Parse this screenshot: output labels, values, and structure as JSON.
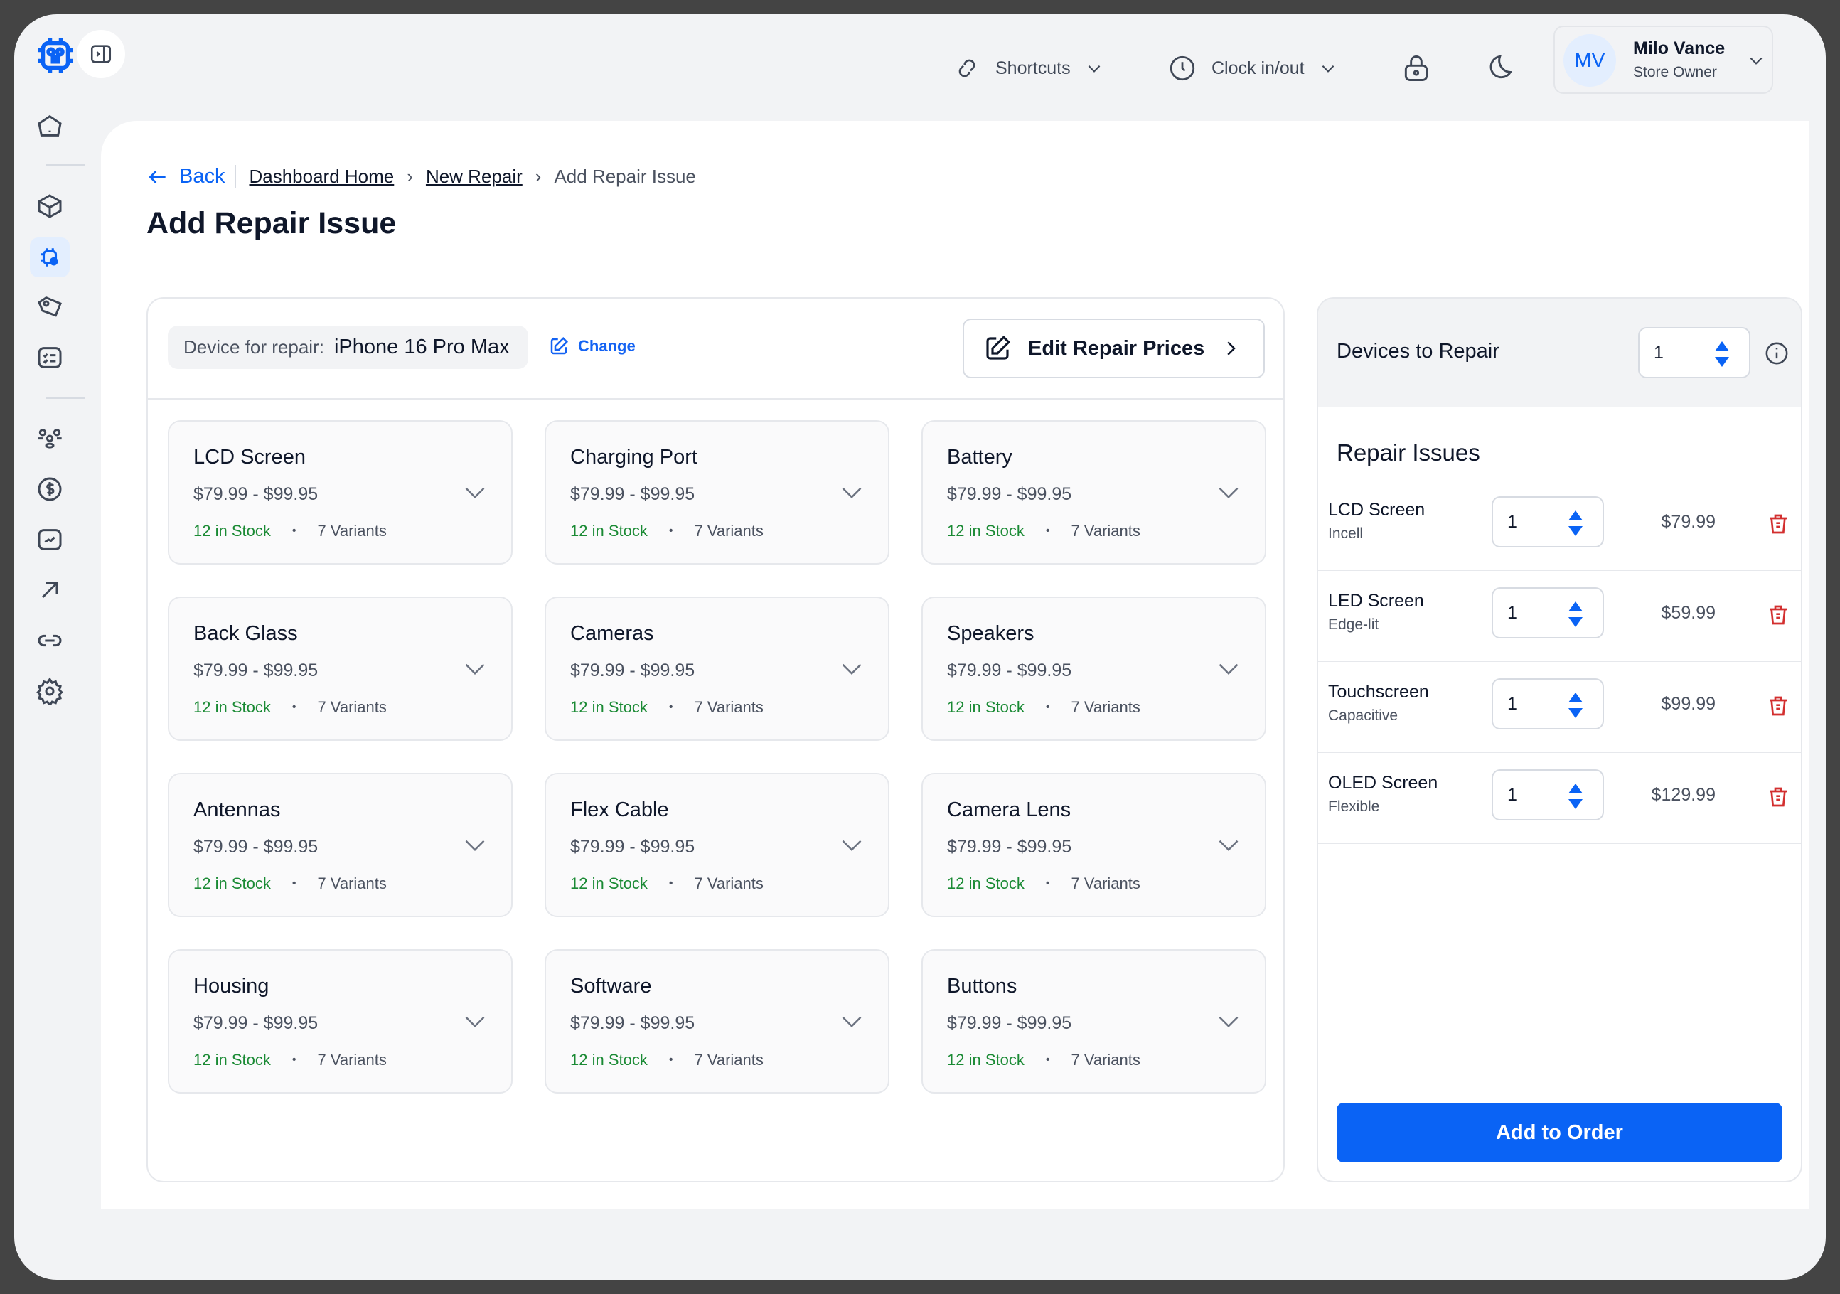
{
  "header": {
    "shortcuts_label": "Shortcuts",
    "clock_label": "Clock in/out",
    "user": {
      "initials": "MV",
      "name": "Milo Vance",
      "role": "Store Owner"
    }
  },
  "breadcrumb": {
    "back": "Back",
    "items": [
      "Dashboard Home",
      "New Repair"
    ],
    "current": "Add Repair Issue"
  },
  "page_title": "Add Repair Issue",
  "device": {
    "label": "Device for repair:",
    "value": "iPhone 16 Pro Max",
    "change": "Change"
  },
  "edit_prices_label": "Edit Repair Prices",
  "issues": [
    {
      "name": "LCD Screen",
      "price": "$79.99 - $99.95",
      "stock": "12 in Stock",
      "variants": "7 Variants"
    },
    {
      "name": "Charging Port",
      "price": "$79.99 - $99.95",
      "stock": "12 in Stock",
      "variants": "7 Variants"
    },
    {
      "name": "Battery",
      "price": "$79.99 - $99.95",
      "stock": "12 in Stock",
      "variants": "7 Variants"
    },
    {
      "name": "Back Glass",
      "price": "$79.99 - $99.95",
      "stock": "12 in Stock",
      "variants": "7 Variants"
    },
    {
      "name": "Cameras",
      "price": "$79.99 - $99.95",
      "stock": "12 in Stock",
      "variants": "7 Variants"
    },
    {
      "name": "Speakers",
      "price": "$79.99 - $99.95",
      "stock": "12 in Stock",
      "variants": "7 Variants"
    },
    {
      "name": "Antennas",
      "price": "$79.99 - $99.95",
      "stock": "12 in Stock",
      "variants": "7 Variants"
    },
    {
      "name": "Flex Cable",
      "price": "$79.99 - $99.95",
      "stock": "12 in Stock",
      "variants": "7 Variants"
    },
    {
      "name": "Camera Lens",
      "price": "$79.99 - $99.95",
      "stock": "12 in Stock",
      "variants": "7 Variants"
    },
    {
      "name": "Housing",
      "price": "$79.99 - $99.95",
      "stock": "12 in Stock",
      "variants": "7 Variants"
    },
    {
      "name": "Software",
      "price": "$79.99 - $99.95",
      "stock": "12 in Stock",
      "variants": "7 Variants"
    },
    {
      "name": "Buttons",
      "price": "$79.99 - $99.95",
      "stock": "12 in Stock",
      "variants": "7 Variants"
    }
  ],
  "summary": {
    "devices_label": "Devices to Repair",
    "devices_qty": "1",
    "issues_title": "Repair Issues",
    "items": [
      {
        "name": "LCD Screen",
        "type": "Incell",
        "qty": "1",
        "price": "$79.99"
      },
      {
        "name": "LED Screen",
        "type": "Edge-lit",
        "qty": "1",
        "price": "$59.99"
      },
      {
        "name": "Touchscreen",
        "type": "Capacitive",
        "qty": "1",
        "price": "$99.99"
      },
      {
        "name": "OLED Screen",
        "type": "Flexible",
        "qty": "1",
        "price": "$129.99"
      }
    ],
    "add_label": "Add to Order"
  },
  "colors": {
    "accent": "#0a63f5",
    "stock": "#1a8a34",
    "delete": "#d32f2f"
  }
}
